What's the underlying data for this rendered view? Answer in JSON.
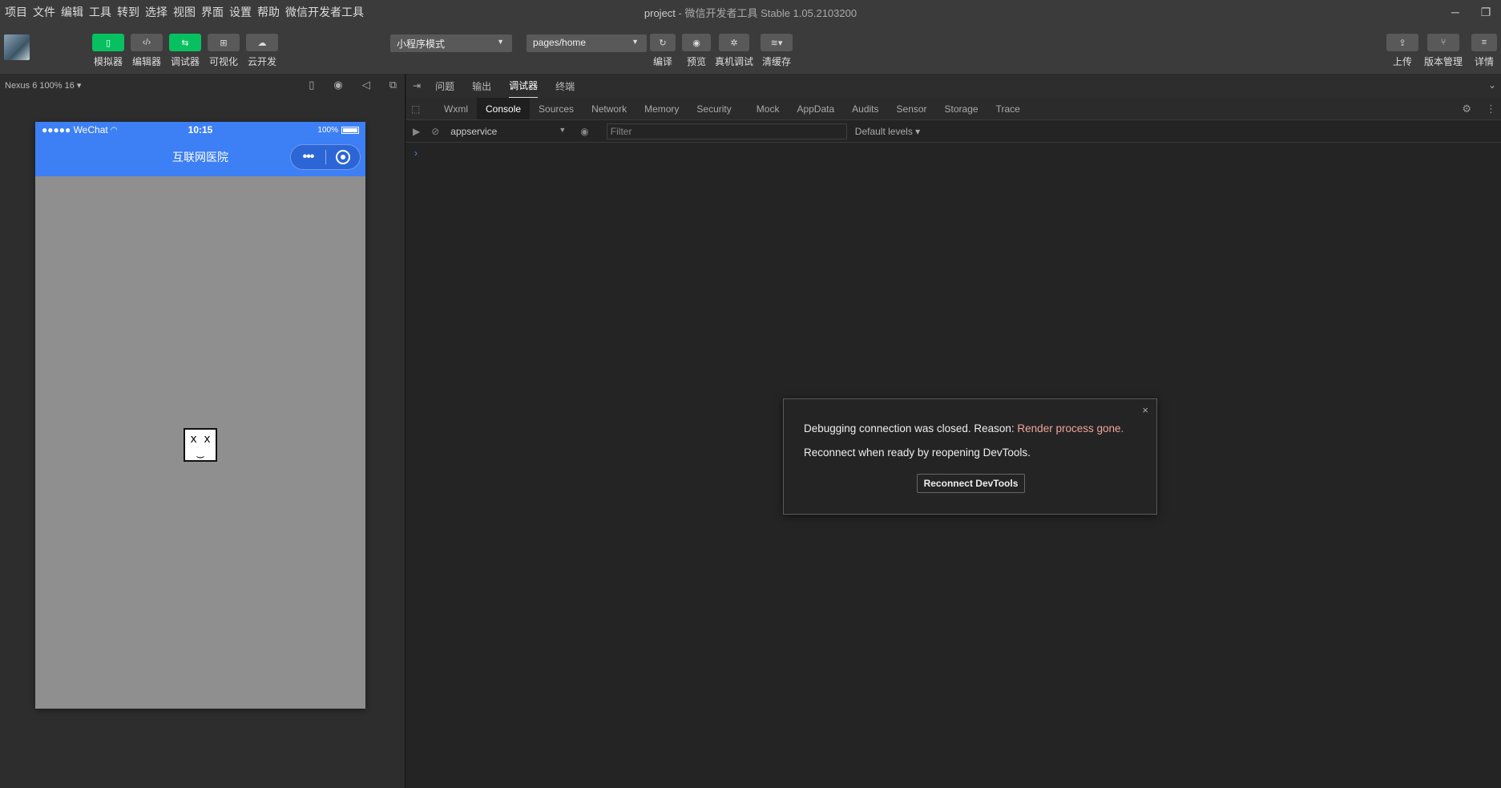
{
  "menu": [
    "项目",
    "文件",
    "编辑",
    "工具",
    "转到",
    "选择",
    "视图",
    "界面",
    "设置",
    "帮助",
    "微信开发者工具"
  ],
  "window": {
    "project": "project",
    "subtitle": " - 微信开发者工具 Stable 1.05.2103200"
  },
  "toolbar": {
    "left_tools": [
      {
        "label": "模拟器",
        "icon": "▯"
      },
      {
        "label": "编辑器",
        "icon": "‹/›"
      },
      {
        "label": "调试器",
        "icon": "⇆"
      },
      {
        "label": "可视化",
        "icon": "⊞"
      },
      {
        "label": "云开发",
        "icon": "☁"
      }
    ],
    "mode_select": "小程序模式",
    "page_select": "pages/home",
    "center_tools": [
      {
        "label": "编译",
        "icon": "↻"
      },
      {
        "label": "预览",
        "icon": "◉"
      },
      {
        "label": "真机调试",
        "icon": "✲"
      },
      {
        "label": "清缓存",
        "icon": "≋▾"
      }
    ],
    "right_tools": [
      {
        "label": "上传",
        "icon": "⇪"
      },
      {
        "label": "版本管理",
        "icon": "⑂"
      },
      {
        "label": "详情",
        "icon": "≡"
      }
    ]
  },
  "simulator": {
    "device": "Nexus 6 100% 16 ▾",
    "status": {
      "carrier": "●●●●● WeChat",
      "time": "10:15",
      "battery": "100%"
    },
    "nav_title": "互联网医院",
    "capsule_dots": "•••",
    "sad_face": "x x\n‿"
  },
  "devpanel": {
    "tabs": [
      "问题",
      "输出",
      "调试器",
      "终端"
    ],
    "active_tab": "调试器",
    "devtools_tabs": [
      "Wxml",
      "Console",
      "Sources",
      "Network",
      "Memory",
      "Security",
      "Mock",
      "AppData",
      "Audits",
      "Sensor",
      "Storage",
      "Trace"
    ],
    "active_devtools_tab": "Console",
    "context": "appservice",
    "filter_placeholder": "Filter",
    "levels": "Default levels ▾",
    "prompt": "›"
  },
  "dialog": {
    "line1_prefix": "Debugging connection was closed. Reason: ",
    "line1_reason": "Render process gone.",
    "line2": "Reconnect when ready by reopening DevTools.",
    "button": "Reconnect DevTools",
    "close": "×"
  },
  "colors": {
    "accent_green": "#07c160",
    "phone_blue": "#3d7ff5",
    "error_text": "#f0a59a"
  }
}
